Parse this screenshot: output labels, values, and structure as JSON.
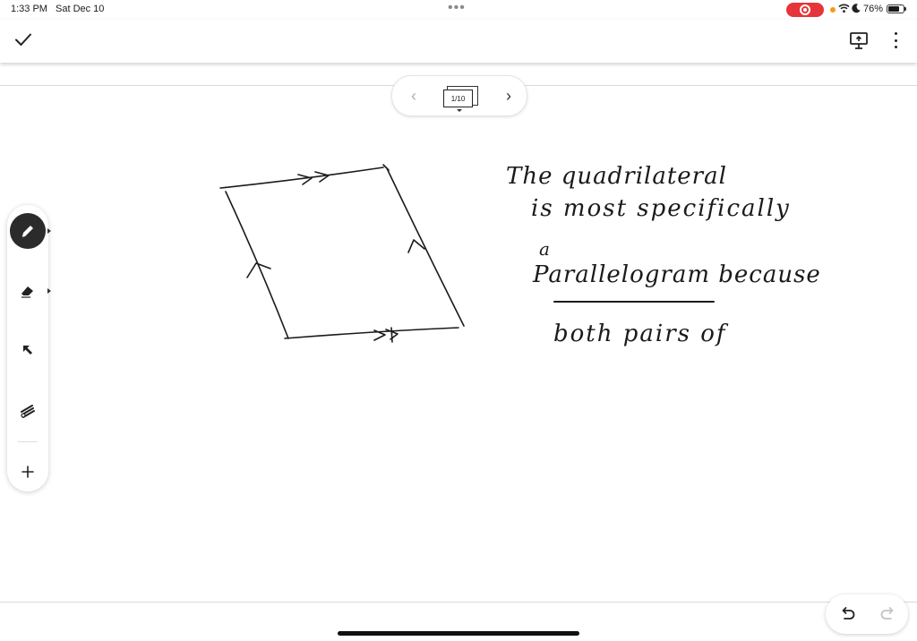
{
  "status_bar": {
    "time": "1:33 PM",
    "date": "Sat Dec 10",
    "battery_percent": "76%",
    "battery_level": 0.76,
    "recording": true,
    "icons": [
      "recording-icon",
      "wifi-icon",
      "do-not-disturb-icon",
      "battery-icon"
    ]
  },
  "toolbar": {
    "done_icon": "checkmark-icon",
    "present_icon": "present-icon",
    "more_icon": "more-options-icon"
  },
  "page_nav": {
    "indicator": "1/10",
    "current_page": 1,
    "total_pages": 10,
    "prev_enabled": false,
    "next_enabled": true
  },
  "tools": [
    {
      "name": "pen-tool",
      "icon": "pen-icon",
      "active": true
    },
    {
      "name": "eraser-tool",
      "icon": "eraser-icon",
      "active": false
    },
    {
      "name": "select-tool",
      "icon": "arrow-pointer-icon",
      "active": false
    },
    {
      "name": "laser-tool",
      "icon": "laser-pointer-icon",
      "active": false
    },
    {
      "name": "add-tool",
      "icon": "plus-icon",
      "active": false
    }
  ],
  "handwriting": {
    "lines": [
      "The quadrilateral",
      "is most specifically",
      "a",
      "Parallelogram because",
      "both pairs of"
    ],
    "underlined_word": "Parallelogram"
  },
  "drawing": {
    "shape": "parallelogram",
    "marks": [
      "double-arrow-top",
      "double-arrow-bottom",
      "single-arrow-left",
      "single-arrow-right"
    ]
  },
  "colors": {
    "ink": "#1a1a1a",
    "record_red": "#e5353a",
    "orange_indicator": "#f29b1d",
    "active_tool_bg": "#2b2b2b"
  }
}
